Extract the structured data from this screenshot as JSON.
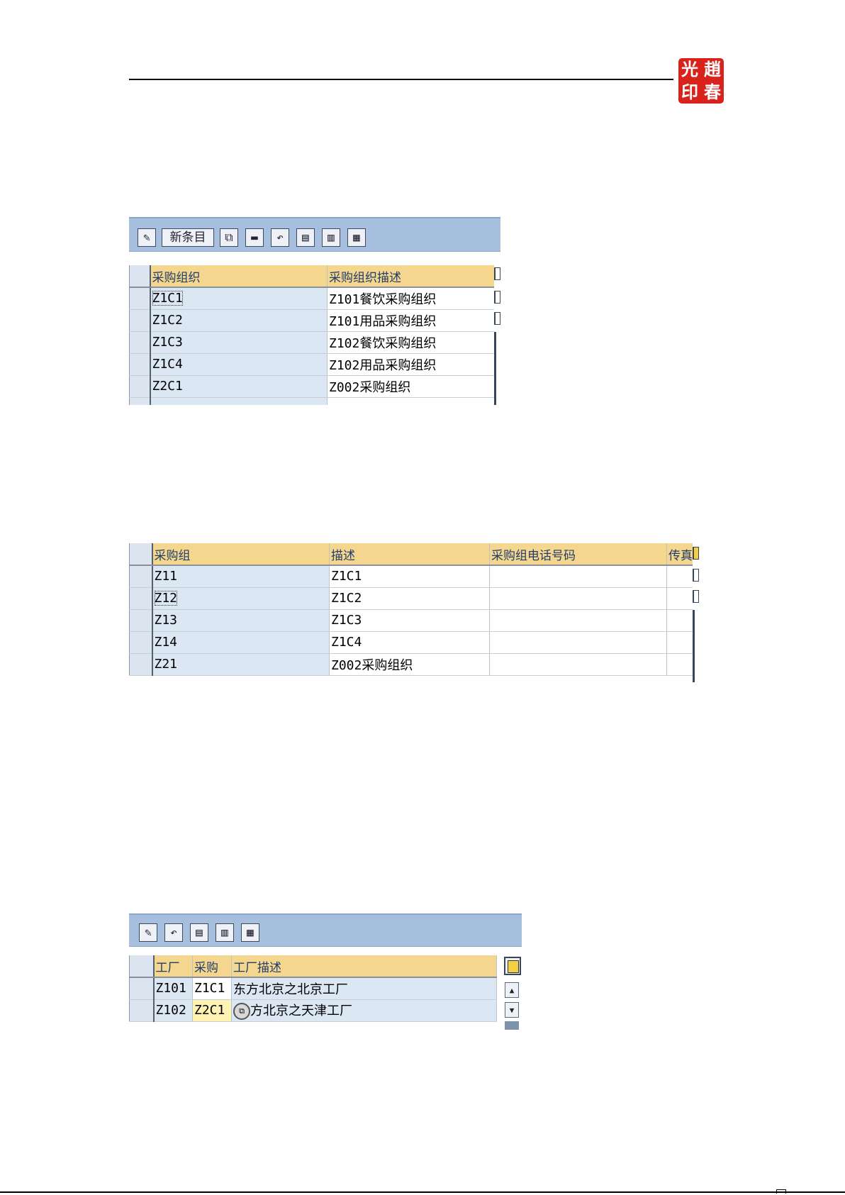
{
  "header": {
    "seal_text": [
      "光",
      "趙",
      "印",
      "春"
    ]
  },
  "toolbar1": {
    "icons": [
      "pencil-glasses-icon",
      "new-entries-button",
      "copy-icon",
      "delete-icon",
      "undo-icon",
      "select-all-icon",
      "select-block-icon",
      "deselect-icon"
    ],
    "new_entries_label": "新条目"
  },
  "table1": {
    "headers": [
      "采购组织",
      "采购组织描述"
    ],
    "rows": [
      [
        "Z1C1",
        "Z101餐饮采购组织"
      ],
      [
        "Z1C2",
        "Z101用品采购组织"
      ],
      [
        "Z1C3",
        "Z102餐饮采购组织"
      ],
      [
        "Z1C4",
        "Z102用品采购组织"
      ],
      [
        "Z2C1",
        "Z002采购组织"
      ]
    ]
  },
  "table2": {
    "headers": [
      "采购组",
      "描述",
      "采购组电话号码",
      "传真"
    ],
    "rows": [
      [
        "Z11",
        "Z1C1",
        "",
        ""
      ],
      [
        "Z12",
        "Z1C2",
        "",
        ""
      ],
      [
        "Z13",
        "Z1C3",
        "",
        ""
      ],
      [
        "Z14",
        "Z1C4",
        "",
        ""
      ],
      [
        "Z21",
        "Z002采购组织",
        "",
        ""
      ]
    ]
  },
  "toolbar3": {
    "icons": [
      "pencil-glasses-icon",
      "undo-icon",
      "select-all-icon",
      "select-block-icon",
      "deselect-icon"
    ]
  },
  "table3": {
    "headers": [
      "工厂",
      "采购",
      "工厂描述"
    ],
    "rows": [
      [
        "Z101",
        "Z1C1",
        "东方北京之北京工厂"
      ],
      [
        "Z102",
        "Z2C1",
        "方北京之天津工厂"
      ]
    ]
  },
  "colors": {
    "toolbar": "#a6bfdf",
    "header": "#f4d68e",
    "key_cell": "#dce7f4",
    "seal": "#d9221c"
  }
}
